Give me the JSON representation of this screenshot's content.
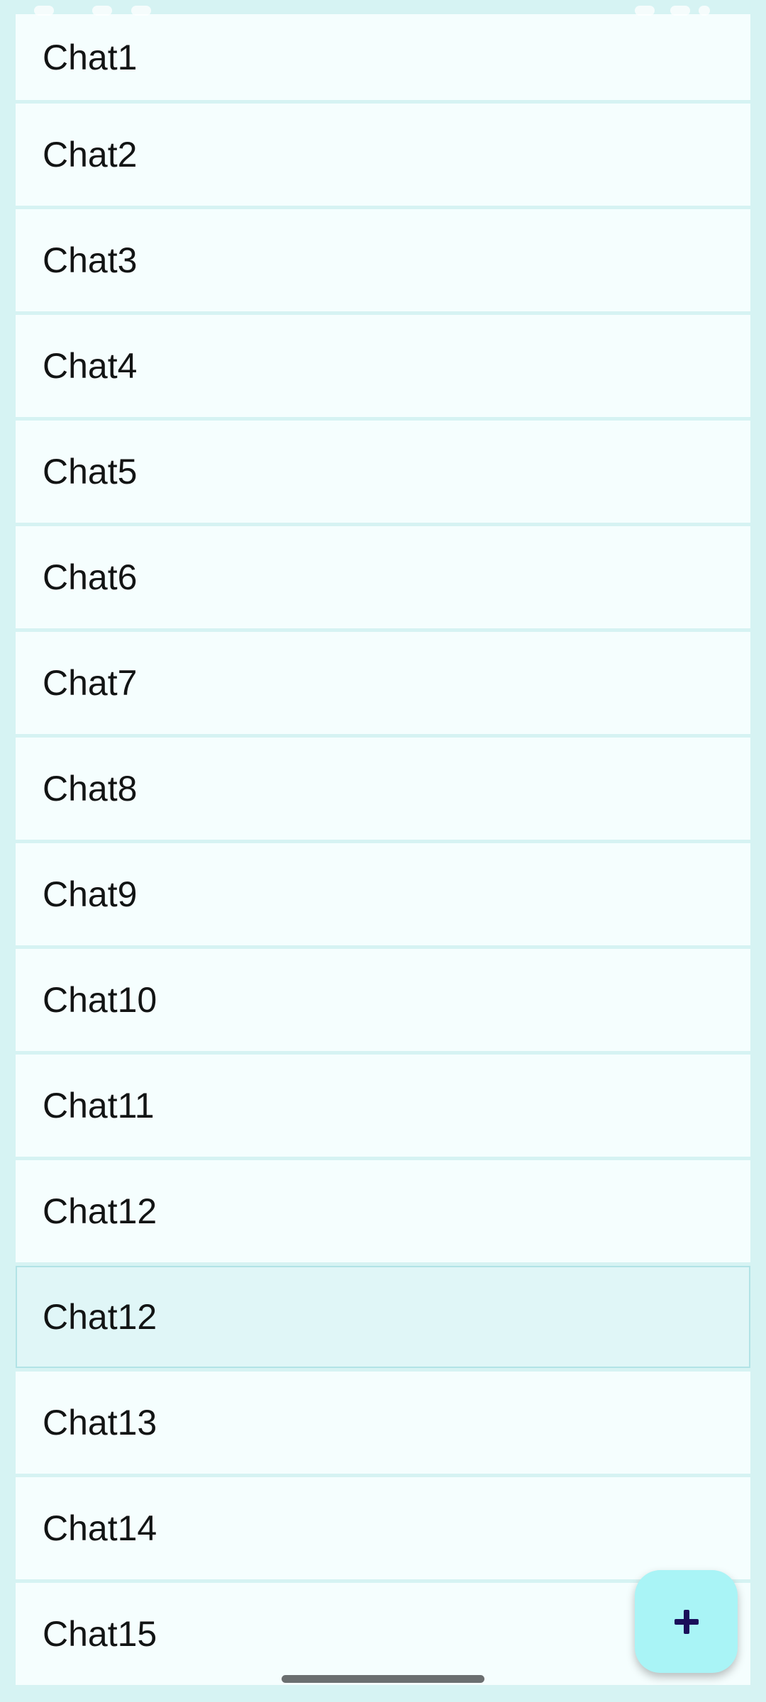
{
  "chats": [
    {
      "label": "Chat1"
    },
    {
      "label": "Chat2"
    },
    {
      "label": "Chat3"
    },
    {
      "label": "Chat4"
    },
    {
      "label": "Chat5"
    },
    {
      "label": "Chat6"
    },
    {
      "label": "Chat7"
    },
    {
      "label": "Chat8"
    },
    {
      "label": "Chat9"
    },
    {
      "label": "Chat10"
    },
    {
      "label": "Chat11"
    },
    {
      "label": "Chat12"
    },
    {
      "label": "Chat12",
      "selected": true
    },
    {
      "label": "Chat13"
    },
    {
      "label": "Chat14"
    },
    {
      "label": "Chat15"
    }
  ],
  "fab": {
    "icon": "plus-icon"
  },
  "colors": {
    "background": "#d6f3f3",
    "item_background": "#f5fefe",
    "selected_background": "#e0f6f7",
    "fab_background": "#a9f4f6",
    "fab_icon": "#1a0e5a"
  }
}
